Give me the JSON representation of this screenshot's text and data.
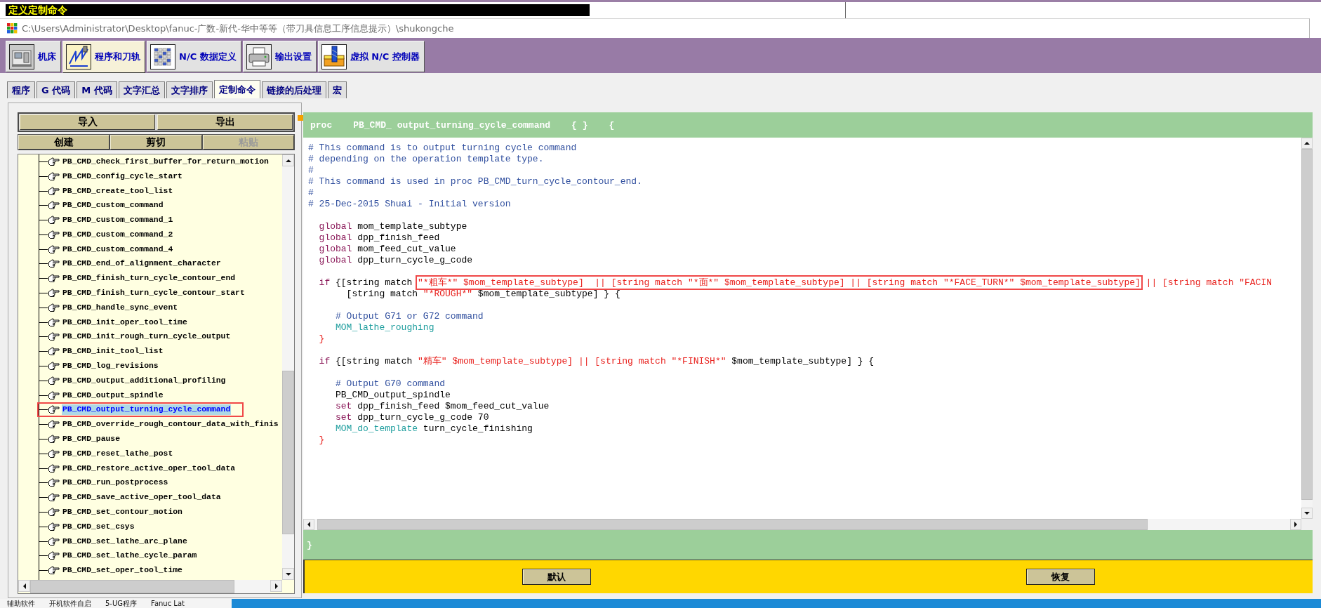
{
  "dialog_title": "定义定制命令",
  "window": {
    "path": "C:\\Users\\Administrator\\Desktop\\fanuc-广数-新代-华中等等（带刀具信息工序信息提示）\\shukongche"
  },
  "main_tabs": [
    {
      "label": "机床",
      "selected": false
    },
    {
      "label": "程序和刀轨",
      "selected": true
    },
    {
      "label": "N/C 数据定义",
      "selected": false
    },
    {
      "label": "输出设置",
      "selected": false
    },
    {
      "label": "虚拟 N/C 控制器",
      "selected": false
    }
  ],
  "sub_tabs": [
    {
      "label": "程序",
      "selected": false
    },
    {
      "label": "G 代码",
      "selected": false
    },
    {
      "label": "M 代码",
      "selected": false
    },
    {
      "label": "文字汇总",
      "selected": false
    },
    {
      "label": "文字排序",
      "selected": false
    },
    {
      "label": "定制命令",
      "selected": true
    },
    {
      "label": "链接的后处理",
      "selected": false
    },
    {
      "label": "宏",
      "selected": false
    }
  ],
  "command_panel": {
    "file_buttons": [
      {
        "label": "导入",
        "disabled": false
      },
      {
        "label": "导出",
        "disabled": false
      }
    ],
    "edit_buttons": [
      {
        "label": "创建",
        "disabled": false
      },
      {
        "label": "剪切",
        "disabled": false
      },
      {
        "label": "粘贴",
        "disabled": true
      }
    ],
    "commands": [
      {
        "label": "PB_CMD_check_first_buffer_for_return_motion",
        "selected": false,
        "annotated": false
      },
      {
        "label": "PB_CMD_config_cycle_start",
        "selected": false,
        "annotated": false
      },
      {
        "label": "PB_CMD_create_tool_list",
        "selected": false,
        "annotated": false
      },
      {
        "label": "PB_CMD_custom_command",
        "selected": false,
        "annotated": false
      },
      {
        "label": "PB_CMD_custom_command_1",
        "selected": false,
        "annotated": false
      },
      {
        "label": "PB_CMD_custom_command_2",
        "selected": false,
        "annotated": false
      },
      {
        "label": "PB_CMD_custom_command_4",
        "selected": false,
        "annotated": false
      },
      {
        "label": "PB_CMD_end_of_alignment_character",
        "selected": false,
        "annotated": false
      },
      {
        "label": "PB_CMD_finish_turn_cycle_contour_end",
        "selected": false,
        "annotated": false
      },
      {
        "label": "PB_CMD_finish_turn_cycle_contour_start",
        "selected": false,
        "annotated": false
      },
      {
        "label": "PB_CMD_handle_sync_event",
        "selected": false,
        "annotated": false
      },
      {
        "label": "PB_CMD_init_oper_tool_time",
        "selected": false,
        "annotated": false
      },
      {
        "label": "PB_CMD_init_rough_turn_cycle_output",
        "selected": false,
        "annotated": false
      },
      {
        "label": "PB_CMD_init_tool_list",
        "selected": false,
        "annotated": false
      },
      {
        "label": "PB_CMD_log_revisions",
        "selected": false,
        "annotated": false
      },
      {
        "label": "PB_CMD_output_additional_profiling",
        "selected": false,
        "annotated": false
      },
      {
        "label": "PB_CMD_output_spindle",
        "selected": false,
        "annotated": false
      },
      {
        "label": "PB_CMD_output_turning_cycle_command",
        "selected": true,
        "annotated": true
      },
      {
        "label": "PB_CMD_override_rough_contour_data_with_finis",
        "selected": false,
        "annotated": false
      },
      {
        "label": "PB_CMD_pause",
        "selected": false,
        "annotated": false
      },
      {
        "label": "PB_CMD_reset_lathe_post",
        "selected": false,
        "annotated": false
      },
      {
        "label": "PB_CMD_restore_active_oper_tool_data",
        "selected": false,
        "annotated": false
      },
      {
        "label": "PB_CMD_run_postprocess",
        "selected": false,
        "annotated": false
      },
      {
        "label": "PB_CMD_save_active_oper_tool_data",
        "selected": false,
        "annotated": false
      },
      {
        "label": "PB_CMD_set_contour_motion",
        "selected": false,
        "annotated": false
      },
      {
        "label": "PB_CMD_set_csys",
        "selected": false,
        "annotated": false
      },
      {
        "label": "PB_CMD_set_lathe_arc_plane",
        "selected": false,
        "annotated": false
      },
      {
        "label": "PB_CMD_set_lathe_cycle_param",
        "selected": false,
        "annotated": false
      },
      {
        "label": "PB_CMD_set_oper_tool_time",
        "selected": false,
        "annotated": false
      }
    ]
  },
  "editor": {
    "header": {
      "keyword": "proc",
      "name": "PB_CMD_ output_turning_cycle_command",
      "args": "{ }",
      "open_brace": "{"
    },
    "blocks": [
      {
        "lines": [
          {
            "segments": [
              {
                "kind": "comment",
                "text": "# This command is to output turning cycle command",
                "annotated": false
              }
            ]
          },
          {
            "segments": [
              {
                "kind": "comment",
                "text": "# depending on the operation template type.",
                "annotated": false
              }
            ]
          },
          {
            "segments": [
              {
                "kind": "comment",
                "text": "#",
                "annotated": false
              }
            ]
          },
          {
            "segments": [
              {
                "kind": "comment",
                "text": "# This command is used in proc PB_CMD_turn_cycle_contour_end.",
                "annotated": false
              }
            ]
          },
          {
            "segments": [
              {
                "kind": "comment",
                "text": "#",
                "annotated": false
              }
            ]
          },
          {
            "segments": [
              {
                "kind": "comment",
                "text": "# 25-Dec-2015 Shuai - Initial version",
                "annotated": false
              }
            ]
          }
        ]
      },
      {
        "lines": [
          {
            "segments": [
              {
                "kind": "keyword",
                "text": "  global",
                "annotated": false
              },
              {
                "kind": "plain",
                "text": " mom_template_subtype",
                "annotated": false
              }
            ]
          },
          {
            "segments": [
              {
                "kind": "keyword",
                "text": "  global",
                "annotated": false
              },
              {
                "kind": "plain",
                "text": " dpp_finish_feed",
                "annotated": false
              }
            ]
          },
          {
            "segments": [
              {
                "kind": "keyword",
                "text": "  global",
                "annotated": false
              },
              {
                "kind": "plain",
                "text": " mom_feed_cut_value",
                "annotated": false
              }
            ]
          },
          {
            "segments": [
              {
                "kind": "keyword",
                "text": "  global",
                "annotated": false
              },
              {
                "kind": "plain",
                "text": " dpp_turn_cycle_g_code",
                "annotated": false
              }
            ]
          }
        ]
      },
      {
        "lines": [
          {
            "segments": [
              {
                "kind": "keyword",
                "text": "  if",
                "annotated": false
              },
              {
                "kind": "plain",
                "text": " {[string match ",
                "annotated": false
              },
              {
                "kind": "string",
                "text": "\"*粗车*\" $mom_template_subtype]  || [string match \"*面*\" $mom_template_subtype] || [string match \"*FACE_TURN*\" $mom_template_subtype]",
                "annotated": true
              },
              {
                "kind": "string",
                "text": " || [string match \"FACIN",
                "annotated": false
              }
            ]
          },
          {
            "segments": [
              {
                "kind": "plain",
                "text": "       [string match ",
                "annotated": false
              },
              {
                "kind": "string",
                "text": "\"*ROUGH*\"",
                "annotated": false
              },
              {
                "kind": "plain",
                "text": " $mom_template_subtype] } {",
                "annotated": false
              }
            ]
          }
        ]
      },
      {
        "lines": [
          {
            "segments": [
              {
                "kind": "comment",
                "text": "     # Output G71 or G72 command",
                "annotated": false
              }
            ]
          },
          {
            "segments": [
              {
                "kind": "command",
                "text": "     MOM_lathe_roughing",
                "annotated": false
              }
            ]
          },
          {
            "segments": [
              {
                "kind": "brace",
                "text": "  }",
                "annotated": false
              }
            ]
          }
        ]
      },
      {
        "lines": [
          {
            "segments": [
              {
                "kind": "keyword",
                "text": "  if",
                "annotated": false
              },
              {
                "kind": "plain",
                "text": " {[string match ",
                "annotated": false
              },
              {
                "kind": "string",
                "text": "\"精车\" $mom_template_subtype] || [string match \"*FINISH*\"",
                "annotated": false
              },
              {
                "kind": "plain",
                "text": " $mom_template_subtype] } {",
                "annotated": false
              }
            ]
          }
        ]
      },
      {
        "lines": [
          {
            "segments": [
              {
                "kind": "comment",
                "text": "     # Output G70 command",
                "annotated": false
              }
            ]
          },
          {
            "segments": [
              {
                "kind": "plain",
                "text": "     PB_CMD_output_spindle",
                "annotated": false
              }
            ]
          },
          {
            "segments": [
              {
                "kind": "keyword",
                "text": "     set",
                "annotated": false
              },
              {
                "kind": "plain",
                "text": " dpp_finish_feed $mom_feed_cut_value",
                "annotated": false
              }
            ]
          },
          {
            "segments": [
              {
                "kind": "keyword",
                "text": "     set",
                "annotated": false
              },
              {
                "kind": "plain",
                "text": " dpp_turn_cycle_g_code 70",
                "annotated": false
              }
            ]
          },
          {
            "segments": [
              {
                "kind": "command",
                "text": "     MOM_do_template",
                "annotated": false
              },
              {
                "kind": "plain",
                "text": " turn_cycle_finishing",
                "annotated": false
              }
            ]
          },
          {
            "segments": [
              {
                "kind": "brace",
                "text": "  }",
                "annotated": false
              }
            ]
          }
        ]
      }
    ],
    "footer": "}"
  },
  "actions": [
    {
      "label": "默认"
    },
    {
      "label": "恢复"
    }
  ],
  "desktop_labels": [
    "辅助软件",
    "开机软件自启",
    "5-UG程序",
    "Fanuc Lat"
  ]
}
